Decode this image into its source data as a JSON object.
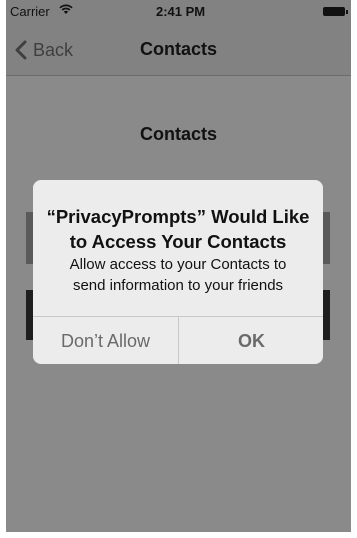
{
  "status_bar": {
    "carrier": "Carrier",
    "time": "2:41 PM",
    "wifi_icon": "wifi-icon",
    "battery_icon": "battery-icon"
  },
  "nav": {
    "back_label": "Back",
    "title": "Contacts"
  },
  "content": {
    "title": "Contacts"
  },
  "alert": {
    "title": "“PrivacyPrompts” Would Like\nto Access Your Contacts",
    "message": "Allow access to your Contacts to\nsend information to your friends",
    "dont_allow_label": "Don’t Allow",
    "ok_label": "OK"
  }
}
